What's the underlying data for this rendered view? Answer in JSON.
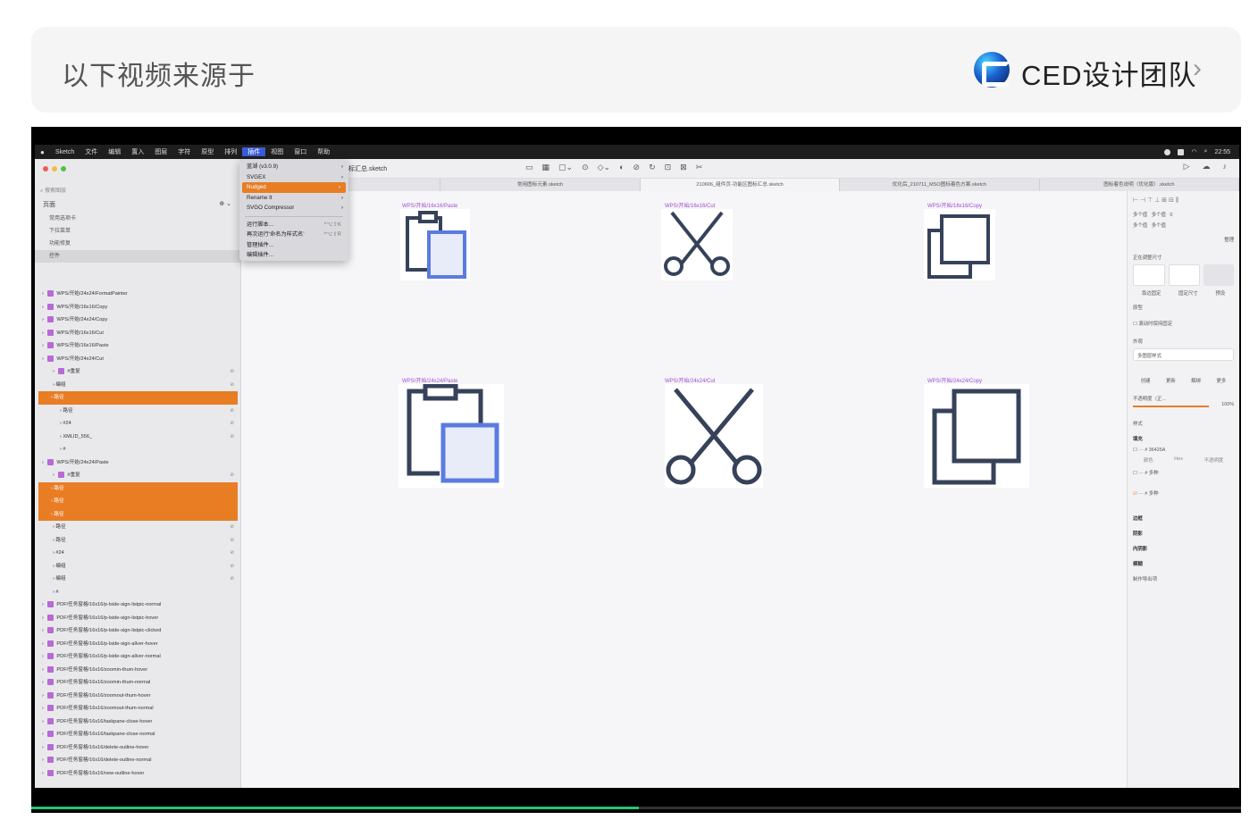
{
  "header": {
    "source_label": "以下视频来源于",
    "team_name": "CED设计团队",
    "chevron": "›"
  },
  "video": {
    "progress_fraction": 0.502
  },
  "menubar": {
    "apple": "",
    "items": [
      "Sketch",
      "文件",
      "编辑",
      "置入",
      "图层",
      "字符",
      "原型",
      "排列",
      "插件",
      "视图",
      "窗口",
      "帮助"
    ],
    "active_index": 8,
    "clock": "22:55"
  },
  "plugin_menu": {
    "items": [
      {
        "label": "蓝湖 (v3.0.9)",
        "arrow": "›"
      },
      {
        "label": "SVGEX",
        "arrow": "›"
      },
      {
        "label": "Nudged",
        "arrow": "›"
      },
      {
        "label": "Rename It",
        "arrow": "›"
      },
      {
        "label": "SVGO Compressor",
        "arrow": "›"
      }
    ],
    "items2": [
      {
        "label": "运行脚本…",
        "shortcut": "^⌥⇧K"
      },
      {
        "label": "再次运行‘命名为样式名’",
        "shortcut": "^⌥⇧R"
      },
      {
        "label": "管理插件…",
        "shortcut": ""
      },
      {
        "label": "编辑插件…",
        "shortcut": ""
      }
    ]
  },
  "titlebar": {
    "doc_title": "图标汇总.sketch"
  },
  "tabs": [
    "etch",
    "常用图标元素.sketch",
    "210606_组件页-功能区图标汇总.sketch",
    "优化后_210711_MSO图标着色方案.sketch",
    "图标着色说明（优化版）.sketch"
  ],
  "sidebar": {
    "search_placeholder": "搜索图层",
    "pages_title": "页面",
    "pages": [
      "常用选项卡",
      "下拉菜单",
      "功能修复",
      "控件"
    ],
    "layers": [
      "WPS/开始/24x24/FormatPainter",
      "WPS/开始/16x16/Copy",
      "WPS/开始/24x24/Copy",
      "WPS/开始/16x16/Cut",
      "WPS/开始/16x16/Paste",
      "WPS/开始/24x24/Cut"
    ],
    "cut_children": [
      "#重复",
      "编组",
      "路径",
      "路径",
      "#24",
      "XMLID_556_",
      "#"
    ],
    "paste_group": "WPS/开始/24x24/Paste",
    "paste_children": [
      "#重复",
      "路径",
      "路径",
      "路径",
      "路径",
      "路径",
      "#24",
      "编组",
      "编组",
      "#"
    ],
    "pdf_layers": [
      "PDF/任务窗格/16x16/p-lside-sign-listpic-normal",
      "PDF/任务窗格/16x16/p-lside-sign-listpic-hover",
      "PDF/任务窗格/16x16/p-lside-sign-listpic-clicked",
      "PDF/任务窗格/16x16/p-lside-sign-allver-hover",
      "PDF/任务窗格/16x16/p-lside-sign-allver-normal",
      "PDF/任务窗格/16x16/zoomin-thum-hover",
      "PDF/任务窗格/16x16/zoomin-thum-normal",
      "PDF/任务窗格/16x16/zoomout-thum-hover",
      "PDF/任务窗格/16x16/zoomout-thum-normal",
      "PDF/任务窗格/16x16/taskpane-close-hover",
      "PDF/任务窗格/16x16/taskpane-close-normal",
      "PDF/任务窗格/16x16/delete-outline-hover",
      "PDF/任务窗格/16x16/delete-outline-normal",
      "PDF/任务窗格/16x16/new-outline-hover"
    ]
  },
  "artboards": {
    "paste16": "WPS/开始/16x16/Paste",
    "cut16": "WPS/开始/16x16/Cut",
    "copy16": "WPS/开始/16x16/Copy",
    "paste24": "WPS/开始/24x24/Paste",
    "cut24": "WPS/开始/24x24/Cut",
    "copy24": "WPS/开始/24x24/Copy"
  },
  "inspector": {
    "multi": "多个值",
    "zero": "0",
    "tidy": "整理",
    "resize_title": "正在调整尺寸",
    "resize_opts": [
      "靠边固定",
      "固定尺寸",
      "预设"
    ],
    "prototype": "原型",
    "fix_scroll": "滚动时保持固定",
    "appearance": "外观",
    "style_select": "多图层样式",
    "style_actions": [
      "创建",
      "更新",
      "解绑",
      "更多"
    ],
    "opacity_label": "不透明度（正…",
    "opacity_value": "100%",
    "style": "样式",
    "fill": "填充",
    "fill_hex": "# 36425A",
    "fill_multi": "# 多种",
    "fill_cols": [
      "颜色",
      "Hex",
      "不透明度"
    ],
    "sections": [
      "边框",
      "阴影",
      "内阴影",
      "模糊",
      "制作导出项"
    ],
    "colors": {
      "accent": "#E87D24",
      "icon": "#36425A",
      "highlight": "#5B7BE0",
      "artboard_label": "#A04FD2"
    }
  }
}
